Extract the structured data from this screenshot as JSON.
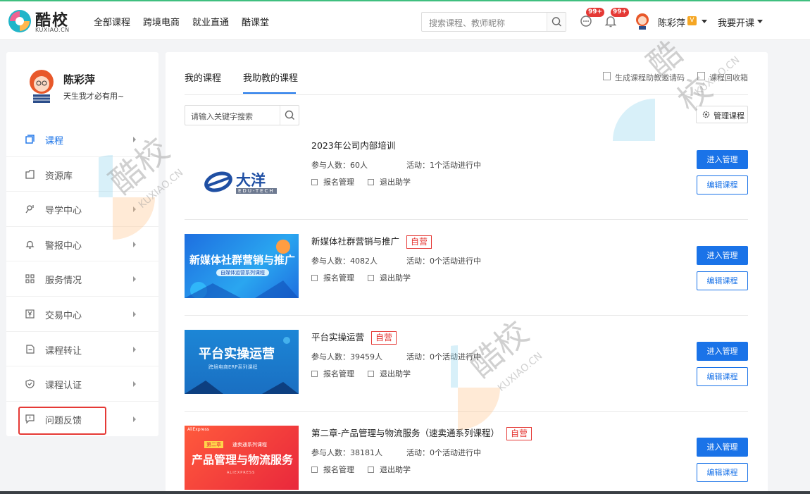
{
  "brand": {
    "name": "酷校",
    "sub": "KUXIAO.CN"
  },
  "nav": [
    "全部课程",
    "跨境电商",
    "就业直通",
    "酷课堂"
  ],
  "search": {
    "placeholder": "搜索课程、教师昵称"
  },
  "badges": {
    "messages": "99+",
    "notifications": "99+"
  },
  "user": {
    "name": "陈彩萍",
    "vip": "V",
    "open_course": "我要开课",
    "motto": "天生我才必有用~"
  },
  "sidebar": {
    "items": [
      {
        "label": "课程",
        "icon": "course-icon"
      },
      {
        "label": "资源库",
        "icon": "folder-icon"
      },
      {
        "label": "导学中心",
        "icon": "guide-icon"
      },
      {
        "label": "警报中心",
        "icon": "bell-icon"
      },
      {
        "label": "服务情况",
        "icon": "grid-icon"
      },
      {
        "label": "交易中心",
        "icon": "yen-icon"
      },
      {
        "label": "课程转让",
        "icon": "transfer-icon"
      },
      {
        "label": "课程认证",
        "icon": "shield-icon"
      },
      {
        "label": "问题反馈",
        "icon": "feedback-icon"
      }
    ]
  },
  "main": {
    "tabs": [
      "我的课程",
      "我助教的课程"
    ],
    "header_links": [
      "生成课程助教邀请码",
      "课程回收箱"
    ],
    "keyword_placeholder": "请输入关键字搜索",
    "manage_label": "管理课程",
    "enter_label": "进入管理",
    "edit_label": "编辑课程",
    "signup_label": "报名管理",
    "quit_label": "退出助学",
    "courses": [
      {
        "title": "2023年公司内部培训",
        "tag": "",
        "participants": "参与人数：60人",
        "activity": "活动：1个活动进行中",
        "thumb_title": "大洋",
        "thumb_sub": "EDU-TECH"
      },
      {
        "title": "新媒体社群营销与推广",
        "tag": "自营",
        "participants": "参与人数：4082人",
        "activity": "活动：0个活动进行中",
        "thumb_title": "新媒体社群营销与推广",
        "thumb_sub": "自媒体运营系列课程"
      },
      {
        "title": "平台实操运营",
        "tag": "自营",
        "participants": "参与人数：39459人",
        "activity": "活动：0个活动进行中",
        "thumb_title": "平台实操运营",
        "thumb_sub": "跨境电商ERP系列课程"
      },
      {
        "title": "第二章-产品管理与物流服务（速卖通系列课程）",
        "tag": "自营",
        "participants": "参与人数：38181人",
        "activity": "活动：0个活动进行中",
        "thumb_title": "产品管理与物流服务",
        "thumb_sub": "速卖通系列课程",
        "thumb_small": "第二章",
        "thumb_brand": "AliExpress",
        "thumb_foot": "ALIEXPRESS"
      }
    ]
  },
  "watermark": {
    "text": "酷校",
    "sub": "KUXIAO.CN"
  },
  "colors": {
    "accent": "#1a73e8",
    "self_tag": "#e53935",
    "highlight": "#e53935"
  }
}
